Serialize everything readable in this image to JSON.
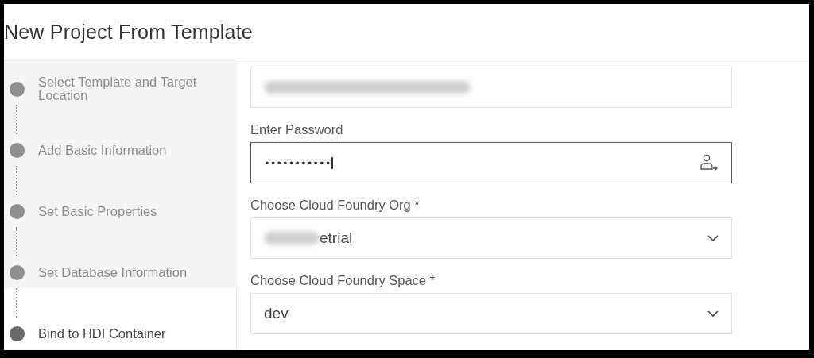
{
  "dialog": {
    "title": "New Project From Template"
  },
  "steps": [
    {
      "label": "Select Template and Target Location",
      "selected": false
    },
    {
      "label": "Add Basic Information",
      "selected": false
    },
    {
      "label": "Set Basic Properties",
      "selected": false
    },
    {
      "label": "Set Database Information",
      "selected": false
    },
    {
      "label": "Bind to HDI Container",
      "selected": true
    }
  ],
  "fields": [
    {
      "kind": "text",
      "redacted": true
    },
    {
      "kind": "password",
      "label": "Enter Password",
      "value": "•••••••••••",
      "focused": true
    },
    {
      "kind": "select",
      "label": "Choose Cloud Foundry Org",
      "required": "*",
      "value": "etrial",
      "redacted": true
    },
    {
      "kind": "select",
      "label": "Choose Cloud Foundry Space",
      "required": "*",
      "value": "dev"
    }
  ]
}
